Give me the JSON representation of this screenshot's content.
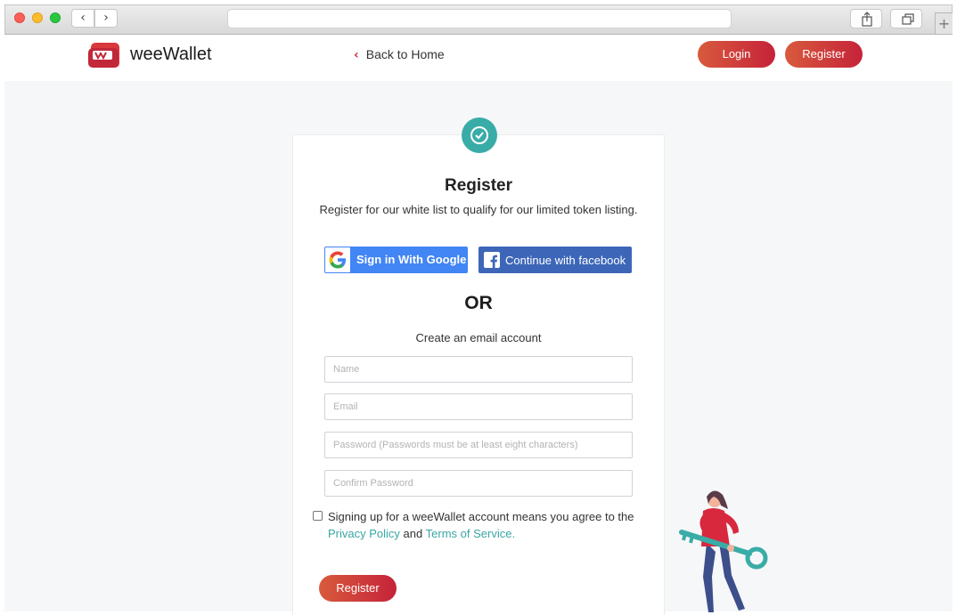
{
  "browser": {
    "back_glyph": "‹",
    "forward_glyph": "›",
    "new_tab_glyph": "+"
  },
  "header": {
    "brand": "weeWallet",
    "back_link": "Back to Home",
    "back_chevron": "‹",
    "login_label": "Login",
    "register_label": "Register"
  },
  "form": {
    "title": "Register",
    "subtitle": "Register for our white list to qualify for our limited token listing.",
    "google_label": "Sign in With Google",
    "facebook_label": "Continue with facebook",
    "or_label": "OR",
    "create_label": "Create an email account",
    "name_placeholder": "Name",
    "email_placeholder": "Email",
    "password_placeholder": "Password (Passwords must be at least eight characters)",
    "confirm_placeholder": "Confirm Password",
    "agree_text": "Signing up for a weeWallet account means you agree to the",
    "privacy_link": "Privacy Policy",
    "and_text": "and",
    "terms_link": "Terms of Service.",
    "submit_label": "Register"
  },
  "colors": {
    "accent_red": "#c5233a",
    "accent_orange": "#d85a3c",
    "teal": "#3aaca7",
    "google_blue": "#4285f4",
    "facebook_blue": "#3d66b8"
  },
  "icons": [
    "weewallet-logo-icon",
    "check-icon",
    "google-icon",
    "facebook-icon",
    "share-icon",
    "tabs-icon",
    "key-illustration"
  ]
}
